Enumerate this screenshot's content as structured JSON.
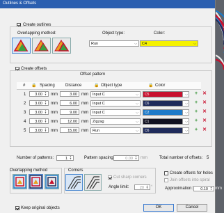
{
  "title": "Outlines & Offsets",
  "outlines": {
    "create_label": "Create outlines",
    "method_label": "Overlapping method:",
    "object_type_label": "Object type:",
    "object_type_value": "Run",
    "color_label": "Color:",
    "color_value": "C4",
    "color_hex": "#f5f200"
  },
  "offsets": {
    "create_label": "Create offsets",
    "pattern_title": "Offset pattern",
    "headers": {
      "num": "#",
      "spacing": "Spacing",
      "distance": "Distance",
      "object_type": "Object type",
      "color": "Color"
    },
    "rows": [
      {
        "num": "1",
        "spacing": "3.00",
        "unit1": "mm",
        "distance": "3.00",
        "unit2": "mm",
        "type": "Input C",
        "color": "C5",
        "hex": "#c8102e"
      },
      {
        "num": "2",
        "spacing": "3.00",
        "unit1": "mm",
        "distance": "6.00",
        "unit2": "mm",
        "type": "Input C",
        "color": "C6",
        "hex": "#1e2a5a"
      },
      {
        "num": "3",
        "spacing": "3.00",
        "unit1": "mm",
        "distance": "9.00",
        "unit2": "mm",
        "type": "Input C",
        "color": "C2",
        "hex": "#1e7ac8"
      },
      {
        "num": "4",
        "spacing": "3.00",
        "unit1": "mm",
        "distance": "12.00",
        "unit2": "mm",
        "type": "Zigzag",
        "color": "C1",
        "hex": "#101020"
      },
      {
        "num": "5",
        "spacing": "3.00",
        "unit1": "mm",
        "distance": "15.00",
        "unit2": "mm",
        "type": "Run",
        "color": "C6",
        "hex": "#1e2a5a"
      }
    ],
    "num_patterns_label": "Number of patterns:",
    "num_patterns_value": "1",
    "pattern_spacing_label": "Pattern spacing:",
    "pattern_spacing_value": "0.00",
    "pattern_spacing_unit": "mm",
    "total_label": "Total number of offsets:",
    "total_value": "5"
  },
  "overlap_method_label": "Overlapping method",
  "corners_label": "Corners",
  "cut_sharp_label": "Cut sharp corners",
  "angle_limit_label": "Angle limit:",
  "angle_limit_value": "20",
  "angle_unit": "°",
  "holes_label": "Create offsets for holes",
  "spiral_label": "Join offsets into spiral",
  "approx_label": "Approximation:",
  "approx_value": "0.10",
  "approx_unit": "mm",
  "keep_label": "Keep original objects",
  "ok_label": "OK",
  "cancel_label": "Cancel"
}
